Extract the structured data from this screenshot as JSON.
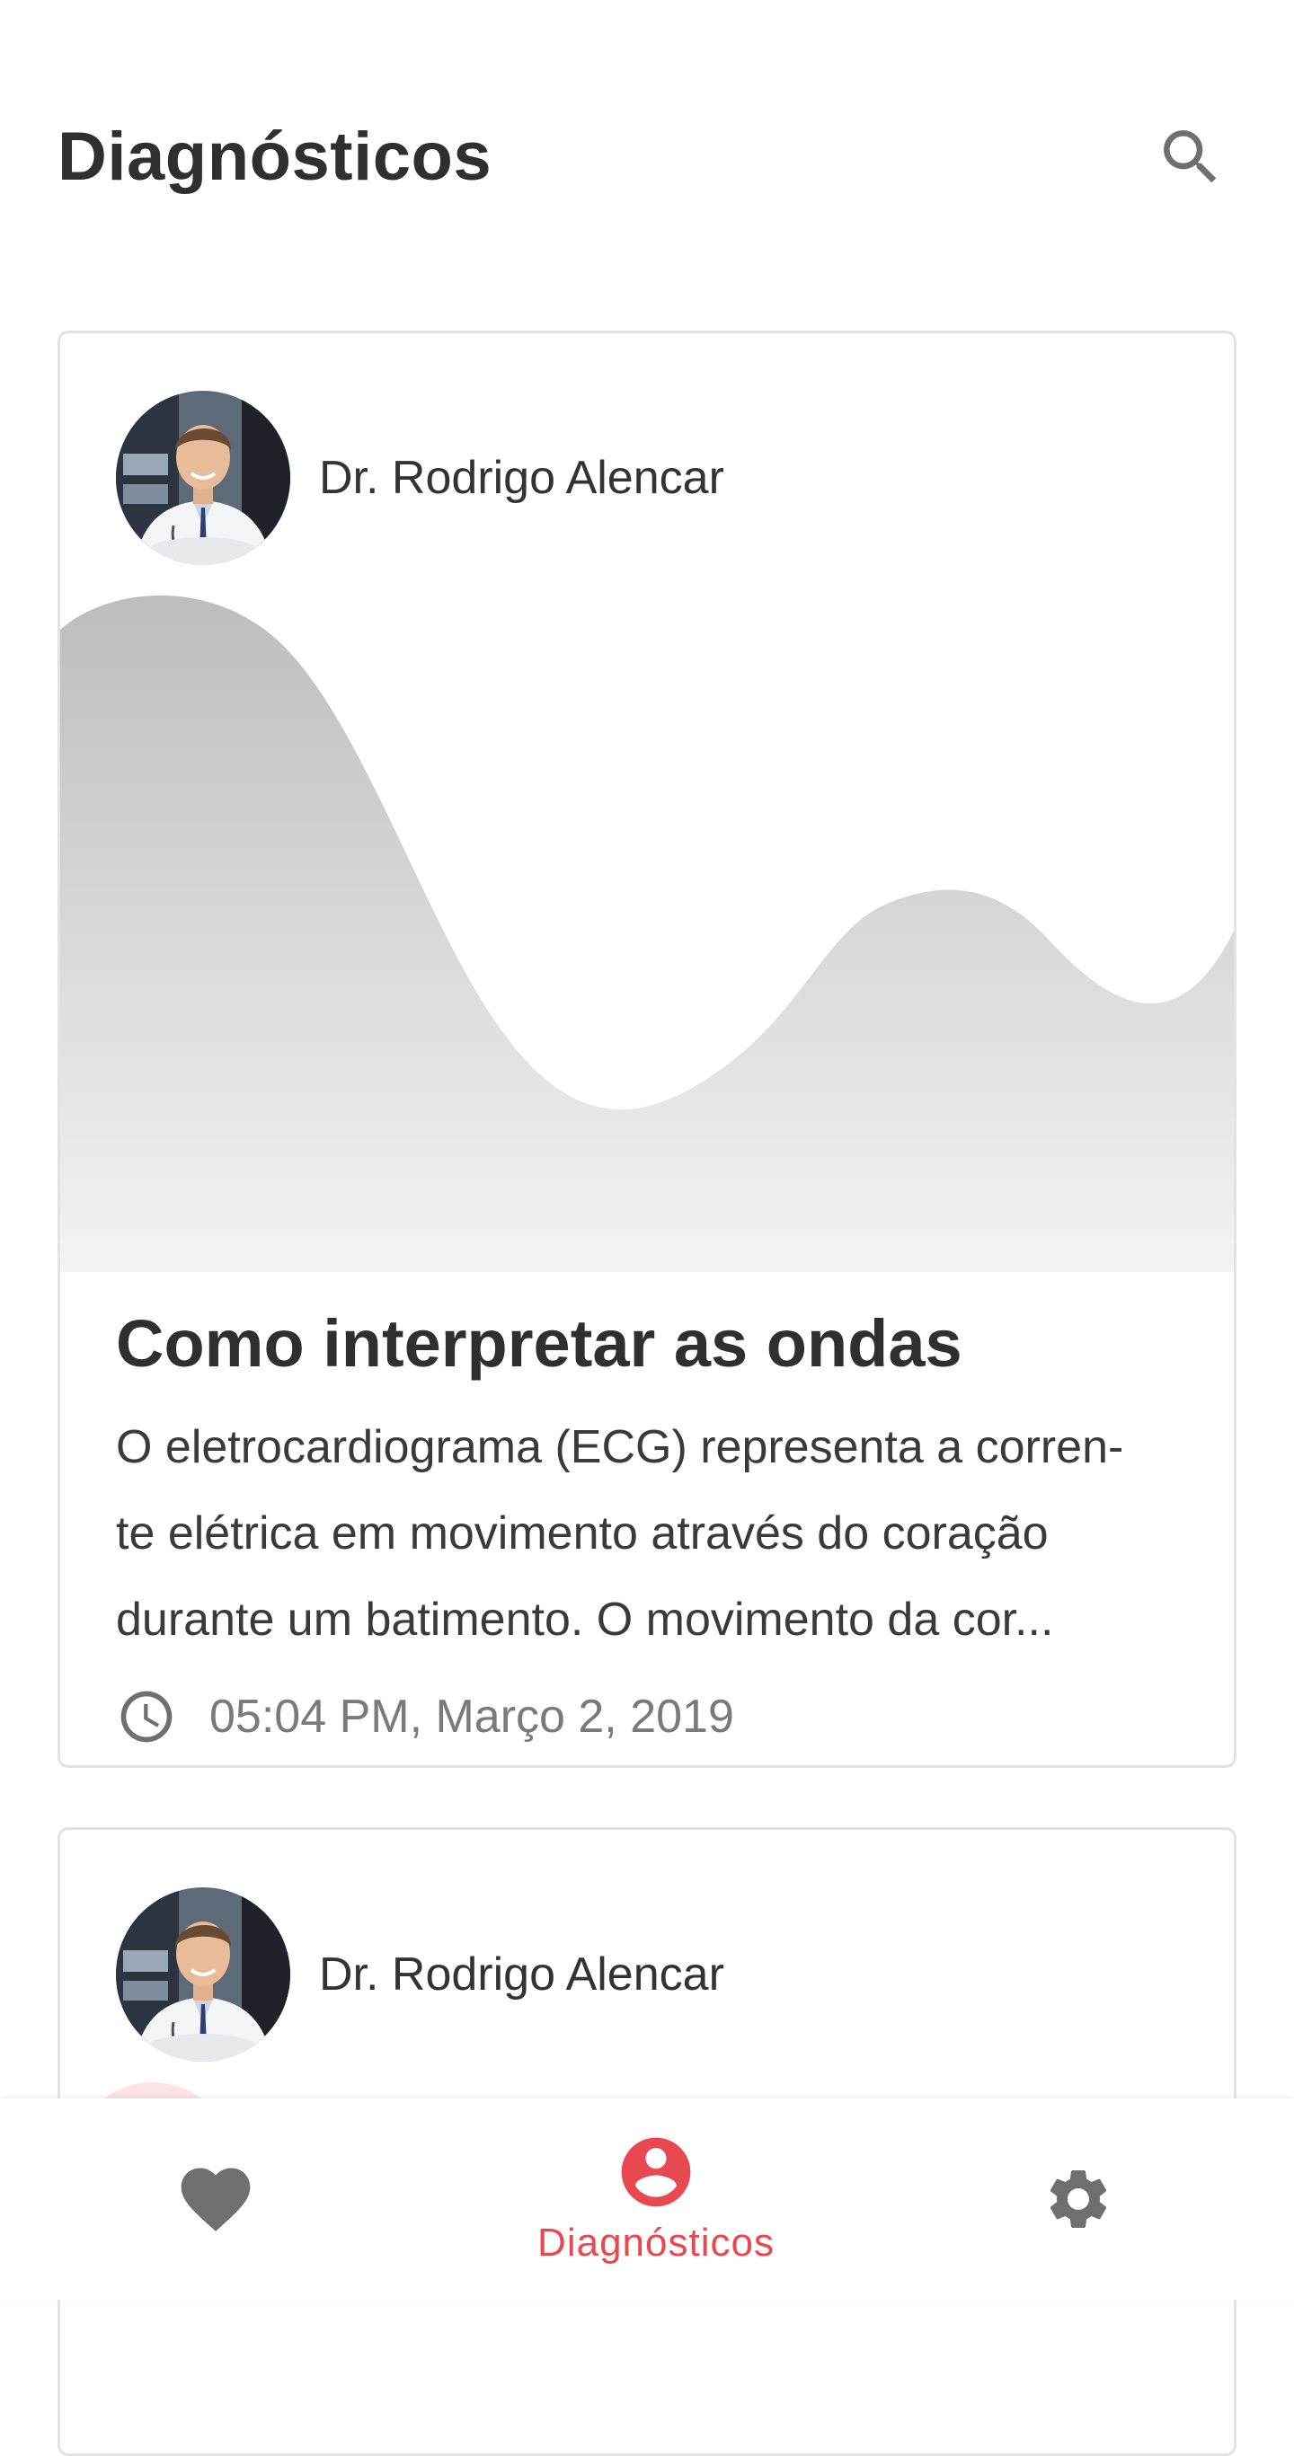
{
  "header": {
    "title": "Diagnósticos",
    "search_icon": "search-icon"
  },
  "cards": [
    {
      "author": "Dr. Rodrigo Alencar",
      "title": "Como interpretar as ondas",
      "excerpt_lines": [
        "O eletrocardiograma (ECG) representa a corren-",
        "te elétrica em movimento através do coração",
        "durante um batimento. O movimento da cor..."
      ],
      "date": "05:04 PM, Março 2, 2019"
    },
    {
      "author": "Dr. Rodrigo Alencar"
    }
  ],
  "bottom_nav": {
    "items": [
      {
        "icon": "heart-icon",
        "label": "",
        "active": false
      },
      {
        "icon": "account-circle-icon",
        "label": "Diagnósticos",
        "active": true
      },
      {
        "icon": "gear-icon",
        "label": "",
        "active": false
      }
    ]
  },
  "colors": {
    "accent": "#e8484f",
    "icon_inactive": "#6f6f6f",
    "wave": "#c4c4c4",
    "card_border": "#e3e3e3"
  }
}
